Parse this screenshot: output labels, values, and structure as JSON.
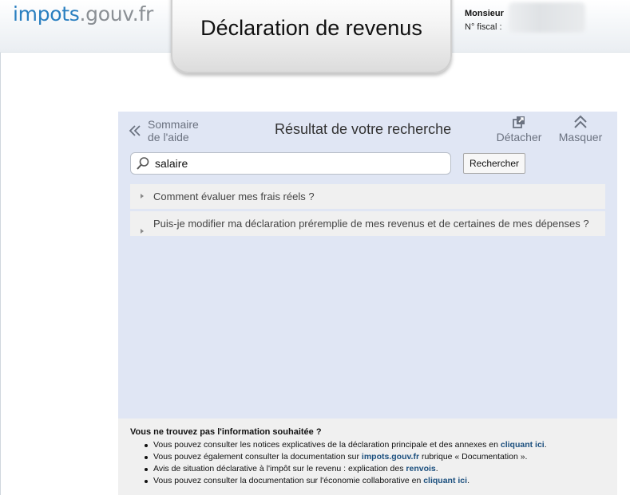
{
  "header": {
    "logo_part1": "impots",
    "logo_part2": ".gouv.fr",
    "title": "Déclaration de revenus",
    "user_name": "Monsieur",
    "fiscal_label": "N° fiscal :"
  },
  "panel": {
    "back_line1": "Sommaire",
    "back_line2": "de l'aide",
    "title": "Résultat de votre recherche",
    "detach_label": "Détacher",
    "hide_label": "Masquer"
  },
  "search": {
    "value": "salaire",
    "button_label": "Rechercher"
  },
  "results": [
    "Comment évaluer mes frais réels ?",
    "Puis-je modifier ma déclaration préremplie de mes revenus et de certaines de mes dépenses ?"
  ],
  "footer": {
    "title": "Vous ne trouvez pas l'information souhaitée ?",
    "items": [
      {
        "text": "Vous pouvez consulter les notices explicatives de la déclaration principale et des annexes en ",
        "link": "cliquant ici",
        "after": "."
      },
      {
        "text": "Vous pouvez également consulter la documentation sur ",
        "link": "impots.gouv.fr",
        "after": " rubrique « Documentation »."
      },
      {
        "text": "Avis de situation déclarative à l'impôt sur le revenu : explication des ",
        "link": "renvois",
        "after": "."
      },
      {
        "text": "Vous pouvez consulter la documentation sur l'économie collaborative en ",
        "link": "cliquant ici",
        "after": "."
      }
    ]
  },
  "colors": {
    "logo_blue": "#2a7fc0",
    "logo_grey": "#8a8f94",
    "panel_bg": "#e0e6f4",
    "link": "#1b4f7e"
  },
  "icons": [
    "chevron-double-left-icon",
    "external-window-icon",
    "chevron-double-up-icon",
    "magnifier-icon"
  ]
}
